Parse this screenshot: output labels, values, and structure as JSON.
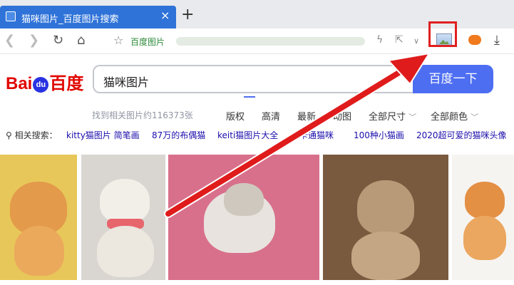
{
  "browser": {
    "tab_title": "猫咪图片_百度图片搜索",
    "tab_close": "×",
    "new_tab": "+",
    "address_host": "百度图片"
  },
  "page": {
    "search_query": "猫咪图片",
    "search_button": "百度一下",
    "result_count": "找到相关图片约116373张",
    "filters": [
      "版权",
      "高清",
      "最新",
      "动图",
      "全部尺寸",
      "全部颜色"
    ],
    "related_lead": "相关搜索：",
    "related": [
      "kitty猫图片 简笔画",
      "87万的布偶猫",
      "keiti猫图片大全",
      "卡通猫咪",
      "100种小猫画",
      "2020超可爱的猫咪头像"
    ]
  },
  "colors": {
    "tab_blue": "#2f73d8",
    "baidu_blue": "#4e6ef2",
    "baidu_red": "#e10602",
    "annotation_red": "#e02020"
  },
  "icons": [
    "back-icon",
    "forward-icon",
    "reload-icon",
    "home-icon",
    "star-icon",
    "lightning-icon",
    "share-icon",
    "chevron-down-icon",
    "image-extension-icon",
    "game-icon",
    "download-icon"
  ]
}
